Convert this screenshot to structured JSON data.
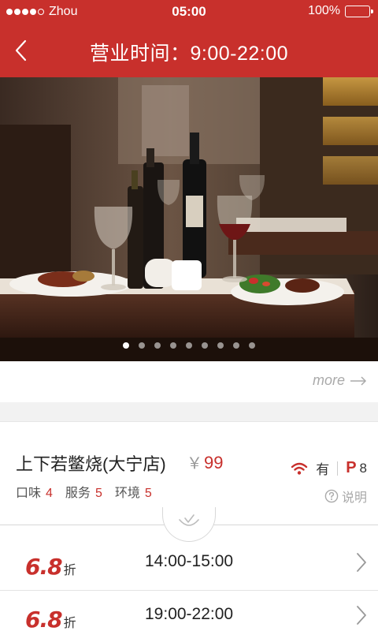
{
  "status_bar": {
    "carrier": "Zhou",
    "time": "05:00",
    "battery": "100%"
  },
  "nav": {
    "title": "营业时间：9:00-22:00"
  },
  "hero": {
    "slide_count": 9,
    "active_slide": 1
  },
  "more": {
    "label": "more"
  },
  "shop": {
    "name": "上下若鳖烧(大宁店)",
    "price_symbol": "￥",
    "price": "99",
    "ratings": [
      {
        "label": "口味",
        "score": "4"
      },
      {
        "label": "服务",
        "score": "5"
      },
      {
        "label": "环境",
        "score": "5"
      }
    ],
    "wifi_label": "有",
    "parking_mark": "P",
    "parking_count": "8",
    "explain_label": "说明"
  },
  "deals": [
    {
      "discount": "6.8",
      "unit": "折",
      "time": "14:00-15:00"
    },
    {
      "discount": "6.8",
      "unit": "折",
      "time": "19:00-22:00"
    }
  ],
  "colors": {
    "brand": "#c8302c",
    "muted": "#aaaaaa"
  }
}
